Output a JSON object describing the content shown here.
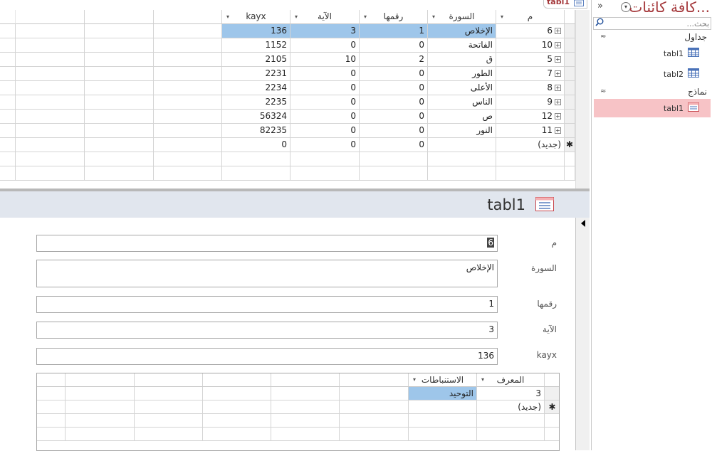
{
  "datasheet": {
    "tab_label": "tabl1",
    "columns": [
      {
        "key": "m",
        "label": "م"
      },
      {
        "key": "sura",
        "label": "السورة"
      },
      {
        "key": "raqm",
        "label": "رقمها"
      },
      {
        "key": "aya",
        "label": "الآية"
      },
      {
        "key": "kayx",
        "label": "kayx"
      }
    ],
    "rows": [
      {
        "m": "6",
        "sura": "الإخلاص",
        "raqm": "1",
        "aya": "3",
        "kayx": "136"
      },
      {
        "m": "10",
        "sura": "الفاتحة",
        "raqm": "0",
        "aya": "0",
        "kayx": "1152"
      },
      {
        "m": "5",
        "sura": "ق",
        "raqm": "2",
        "aya": "10",
        "kayx": "2105"
      },
      {
        "m": "7",
        "sura": "الطور",
        "raqm": "0",
        "aya": "0",
        "kayx": "2231"
      },
      {
        "m": "8",
        "sura": "الأعلى",
        "raqm": "0",
        "aya": "0",
        "kayx": "2234"
      },
      {
        "m": "9",
        "sura": "الناس",
        "raqm": "0",
        "aya": "0",
        "kayx": "2235"
      },
      {
        "m": "12",
        "sura": "ص",
        "raqm": "0",
        "aya": "0",
        "kayx": "56324"
      },
      {
        "m": "11",
        "sura": "النور",
        "raqm": "0",
        "aya": "0",
        "kayx": "82235"
      }
    ],
    "new_row": {
      "m": "(جديد)",
      "raqm": "0",
      "aya": "0",
      "kayx": "0"
    },
    "new_row_marker": "✱",
    "selected_row": 0
  },
  "form": {
    "title": "tabl1",
    "fields": [
      {
        "label": "م",
        "value": "6"
      },
      {
        "label": "السورة",
        "value": "الإخلاص"
      },
      {
        "label": "رقمها",
        "value": "1"
      },
      {
        "label": "الآية",
        "value": "3"
      },
      {
        "label": "kayx",
        "value": "136"
      }
    ],
    "subform": {
      "columns": [
        "المعرف",
        "الاستنباطات"
      ],
      "rows": [
        {
          "id": "3",
          "istinbat": "التوحيد"
        }
      ],
      "new_row": "(جديد)",
      "new_row_marker": "✱"
    }
  },
  "nav": {
    "title": "كافة كائنات...",
    "collapse_glyph": "»",
    "dropdown_glyph": "▾",
    "search_placeholder": "بحث...",
    "groups": [
      {
        "label": "جداول",
        "chevron": "≈",
        "items": [
          "tabl1",
          "tabl2"
        ]
      },
      {
        "label": "نماذج",
        "chevron": "≈",
        "items": [
          "tabl1"
        ]
      }
    ],
    "selected_item": "forms.tabl1"
  },
  "colors": {
    "title_accent": "#a4373a",
    "selection_blue": "#9ec6ea",
    "nav_selected": "#f7c3c6",
    "form_header": "#e1e6ee"
  }
}
